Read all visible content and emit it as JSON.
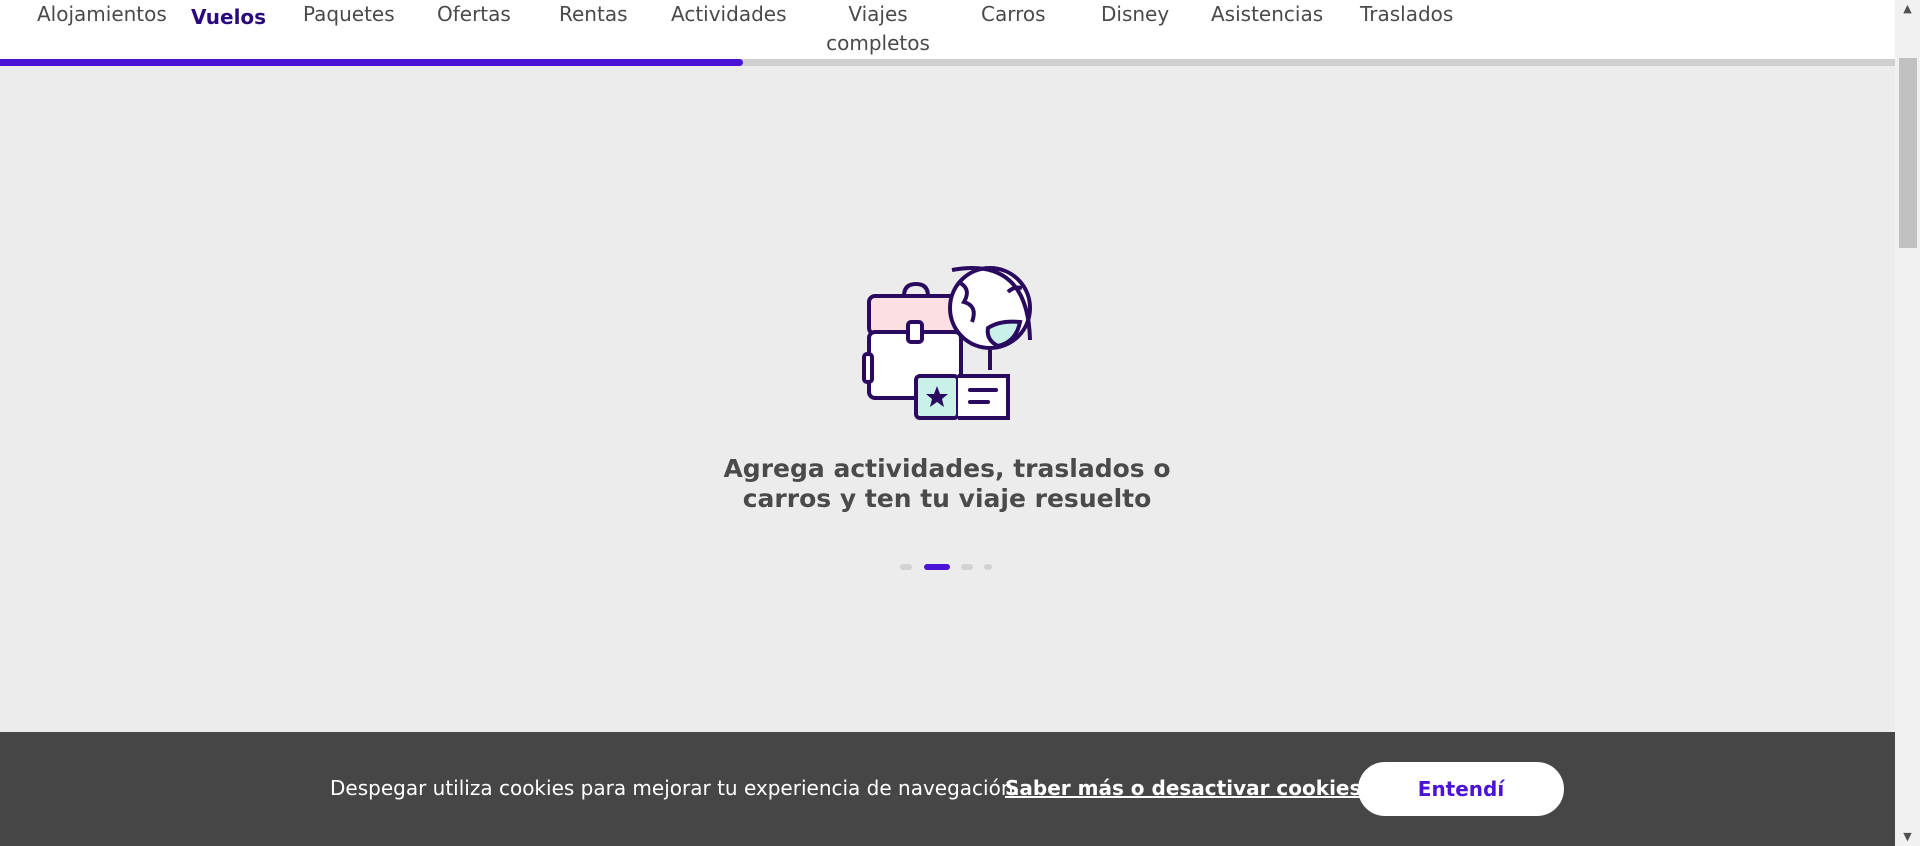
{
  "nav": {
    "items": [
      {
        "label": "Alojamientos"
      },
      {
        "label": "Vuelos"
      },
      {
        "label": "Paquetes"
      },
      {
        "label": "Ofertas"
      },
      {
        "label": "Rentas"
      },
      {
        "label": "Actividades"
      },
      {
        "label": "Viajes completos"
      },
      {
        "label": "Carros"
      },
      {
        "label": "Disney"
      },
      {
        "label": "Asistencias"
      },
      {
        "label": "Traslados"
      }
    ],
    "active_index": 1,
    "progress_fraction": 0.392
  },
  "carousel": {
    "slide_text": "Agrega actividades, traslados o carros y ten tu viaje resuelto",
    "illustration_icon": "briefcase-globe-ticket-icon",
    "dot_count": 4,
    "active_dot": 1
  },
  "cookies": {
    "message": "Despegar utiliza cookies para mejorar tu experiencia de navegación.",
    "link_label": "Saber más o desactivar cookies.",
    "accept_label": "Entendí"
  },
  "colors": {
    "accent": "#4a13d6",
    "active_nav": "#2a0a7a",
    "banner_bg": "#464646",
    "page_bg": "#ececec"
  }
}
